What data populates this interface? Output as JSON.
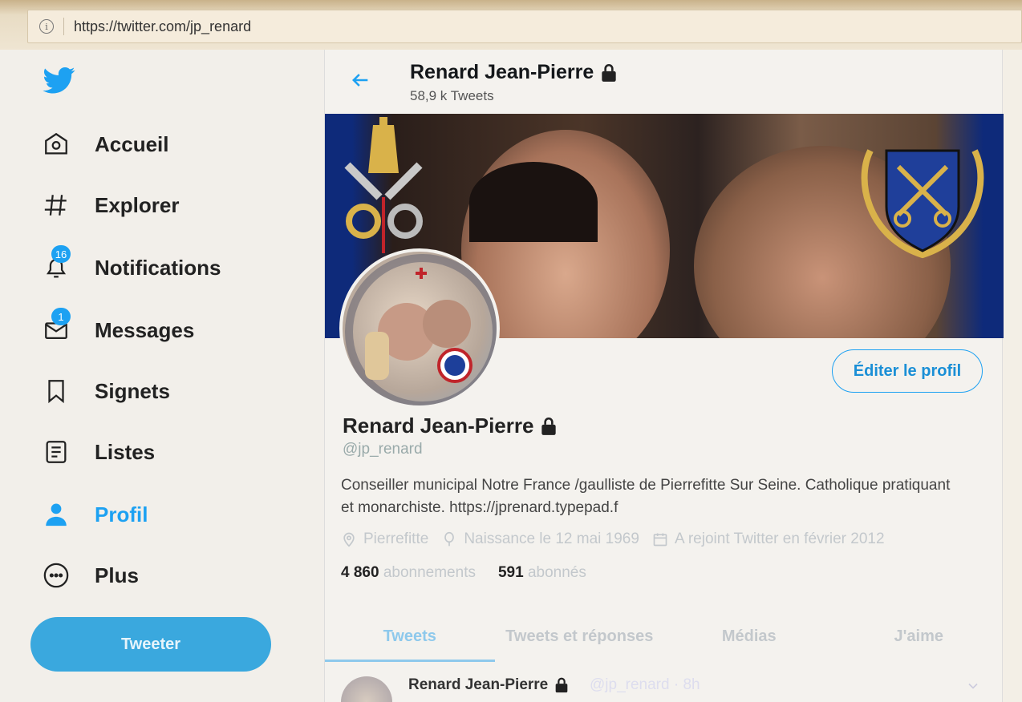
{
  "browser": {
    "url": "https://twitter.com/jp_renard"
  },
  "sidebar": {
    "items": [
      {
        "label": "Accueil",
        "icon": "home-icon"
      },
      {
        "label": "Explorer",
        "icon": "hashtag-icon"
      },
      {
        "label": "Notifications",
        "icon": "bell-icon",
        "badge": "16"
      },
      {
        "label": "Messages",
        "icon": "envelope-icon",
        "badge": "1"
      },
      {
        "label": "Signets",
        "icon": "bookmark-icon"
      },
      {
        "label": "Listes",
        "icon": "list-icon"
      },
      {
        "label": "Profil",
        "icon": "user-icon",
        "active": true
      },
      {
        "label": "Plus",
        "icon": "more-icon"
      }
    ],
    "tweet_button": "Tweeter"
  },
  "header": {
    "name": "Renard Jean-Pierre",
    "tweet_count": "58,9 k Tweets"
  },
  "profile": {
    "edit_button": "Éditer le profil",
    "name": "Renard Jean-Pierre",
    "handle": "@jp_renard",
    "bio": "Conseiller municipal Notre France /gaulliste de Pierrefitte Sur Seine. Catholique pratiquant et monarchiste. https://jprenard.typepad.f",
    "location": "Pierrefitte",
    "birthday": "Naissance le 12 mai 1969",
    "joined": "A rejoint Twitter en février 2012",
    "following_count": "4 860",
    "following_label": "abonnements",
    "followers_count": "591",
    "followers_label": "abonnés"
  },
  "tabs": [
    {
      "label": "Tweets",
      "active": true
    },
    {
      "label": "Tweets et réponses"
    },
    {
      "label": "Médias"
    },
    {
      "label": "J'aime"
    }
  ],
  "tweet": {
    "author": "Renard Jean-Pierre",
    "meta": "@jp_renard · 8h"
  },
  "colors": {
    "accent": "#1da1f2",
    "banner_blue": "#0e2a7a"
  }
}
